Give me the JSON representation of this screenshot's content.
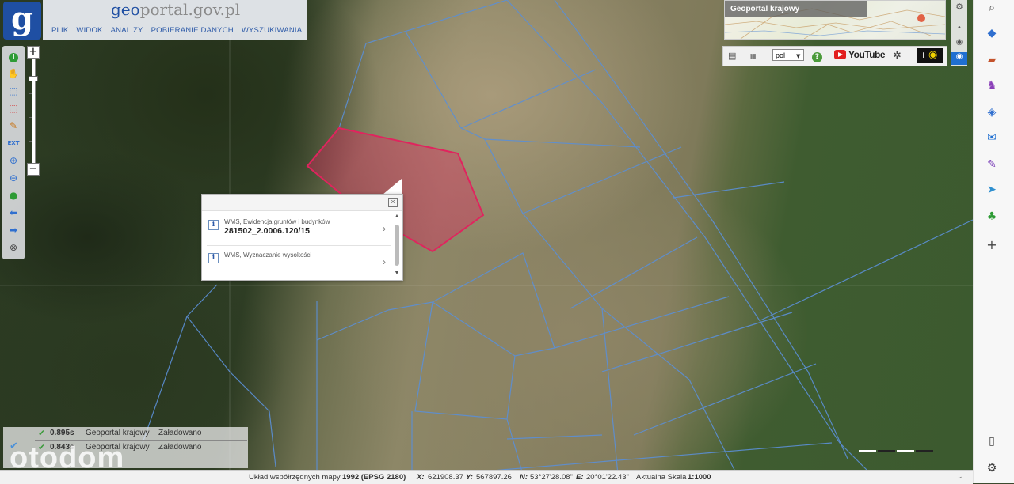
{
  "app": {
    "logo_letter": "g",
    "site": "geoportal.gov.pl",
    "site_prefix": "geo",
    "site_rest": "portal.gov.pl"
  },
  "menu": [
    "PLIK",
    "WIDOK",
    "ANALIZY",
    "POBIERANIE DANYCH",
    "WYSZUKIWANIA"
  ],
  "left_tools": [
    "info-icon",
    "pan-hand-icon",
    "select-icon",
    "clear-selection-icon",
    "pencil-icon",
    "zoom-extent-icon",
    "zoom-in-icon",
    "zoom-out-icon",
    "globe-icon",
    "back-arrow-icon",
    "forward-arrow-icon",
    "crosshair-icon"
  ],
  "zoom": {
    "plus": "+",
    "minus": "−"
  },
  "popup": {
    "rows": [
      {
        "icon": "i",
        "layer": "WMS, Ewidencja gruntów i budynków",
        "value": "281502_2.0006.120/15"
      },
      {
        "icon": "i",
        "layer": "WMS, Wyznaczanie wysokości",
        "value": ""
      }
    ],
    "close": "×"
  },
  "minimap": {
    "title": "Geoportal krajowy"
  },
  "tools2": {
    "language": "pol",
    "youtube": "YouTube"
  },
  "layers_panel": [
    {
      "time": "0.895s",
      "name": "Geoportal krajowy",
      "status": "Załadowano"
    },
    {
      "time": "0.843s",
      "name": "Geoportal krajowy",
      "status": "Załadowano"
    }
  ],
  "status": {
    "crs_label": "Układ współrzędnych mapy",
    "crs_value": "1992 (EPSG 2180)",
    "x_label": "X:",
    "x_value": "621908.37",
    "y_label": "Y:",
    "y_value": "567897.26",
    "n_label": "N:",
    "n_value": "53°27'28.08\"",
    "e_label": "E:",
    "e_value": "20°01'22.43\"",
    "scale_label": "Aktualna Skala",
    "scale_value": "1:1000"
  },
  "watermark": "otodom",
  "colors": {
    "parcel_highlight": "#e0245e",
    "parcel_lines": "#5b8fd6",
    "brand_blue": "#1f4fa3"
  }
}
